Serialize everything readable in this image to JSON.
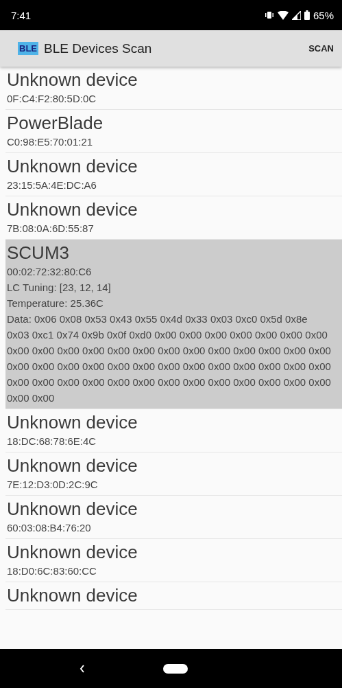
{
  "status_bar": {
    "time": "7:41",
    "battery": "65%"
  },
  "app_bar": {
    "title": "BLE Devices Scan",
    "logo": "BLE",
    "action": "SCAN"
  },
  "devices": [
    {
      "name": "Unknown device",
      "address": "0F:C4:F2:80:5D:0C",
      "selected": false
    },
    {
      "name": "PowerBlade",
      "address": "C0:98:E5:70:01:21",
      "selected": false
    },
    {
      "name": "Unknown device",
      "address": "23:15:5A:4E:DC:A6",
      "selected": false
    },
    {
      "name": "Unknown device",
      "address": "7B:08:0A:6D:55:87",
      "selected": false
    },
    {
      "name": "SCUM3",
      "address": "00:02:72:32:80:C6",
      "selected": true,
      "details": [
        "LC Tuning: [23, 12, 14]",
        "Temperature: 25.36C",
        "Data: 0x06 0x08 0x53 0x43 0x55 0x4d 0x33 0x03 0xc0 0x5d 0x8e 0x03 0xc1 0x74 0x9b 0x0f 0xd0 0x00 0x00 0x00 0x00 0x00 0x00 0x00 0x00 0x00 0x00 0x00 0x00 0x00 0x00 0x00 0x00 0x00 0x00 0x00 0x00 0x00 0x00 0x00 0x00 0x00 0x00 0x00 0x00 0x00 0x00 0x00 0x00 0x00 0x00 0x00 0x00 0x00 0x00 0x00 0x00 0x00 0x00 0x00 0x00 0x00 0x00 0x00 0x00"
      ]
    },
    {
      "name": "Unknown device",
      "address": "18:DC:68:78:6E:4C",
      "selected": false
    },
    {
      "name": "Unknown device",
      "address": "7E:12:D3:0D:2C:9C",
      "selected": false
    },
    {
      "name": "Unknown device",
      "address": "60:03:08:B4:76:20",
      "selected": false
    },
    {
      "name": "Unknown device",
      "address": "18:D0:6C:83:60:CC",
      "selected": false
    },
    {
      "name": "Unknown device",
      "selected": false
    }
  ]
}
